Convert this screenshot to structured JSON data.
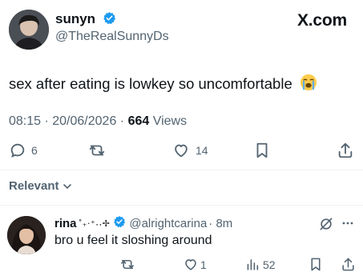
{
  "brand": {
    "label": "X.com"
  },
  "tweet": {
    "author_name": "sunyn",
    "author_handle": "@TheRealSunnyDs",
    "text": "sex after eating is lowkey so uncomfortable",
    "emoji": "loudly-crying-face-icon",
    "timestamp": "08:15 · 20/06/2026 · ",
    "views_count": "664",
    "views_label": " Views",
    "replies": "6",
    "likes": "14"
  },
  "sort": {
    "label": "Relevant"
  },
  "reply": {
    "author_name": "rina",
    "author_deco": "˚₊‧⁺˖˖✢",
    "author_handle": "@alrightcarina",
    "time": "· 8m",
    "text": "bro u feel it sloshing around",
    "likes": "1",
    "views": "52"
  },
  "colors": {
    "verified": "#1d9bf0",
    "text": "#0f1419",
    "secondary": "#536471",
    "divider": "#eff3f4"
  }
}
